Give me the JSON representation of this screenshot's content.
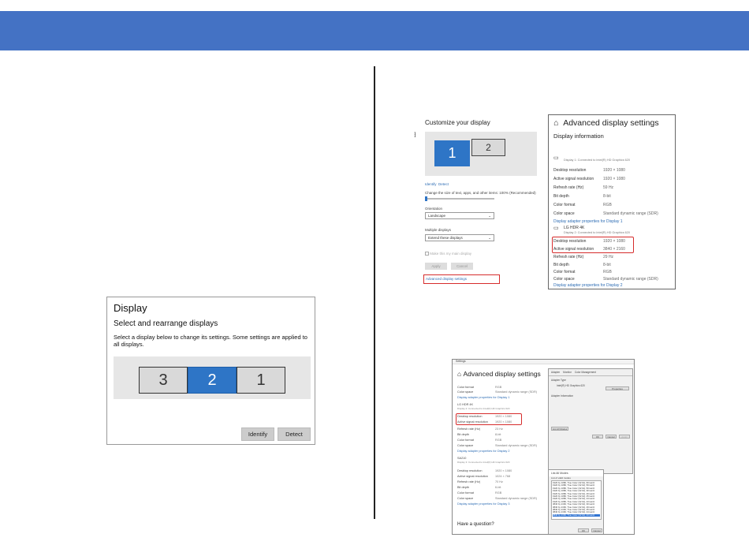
{
  "display_panel": {
    "title": "Display",
    "subtitle": "Select and rearrange displays",
    "description": "Select a display below to change its settings. Some settings are applied to all displays.",
    "monitors": [
      "3",
      "2",
      "1"
    ],
    "identify_label": "Identify",
    "detect_label": "Detect"
  },
  "customize_panel": {
    "title": "Customize your display",
    "tick": "⁆",
    "monitors": [
      "1",
      "2"
    ],
    "identify_label": "Identify",
    "detect_label": "Detect",
    "scale_label": "Change the size of text, apps, and other items: 100% (Recommended)",
    "orientation_label": "Orientation",
    "orientation_value": "Landscape",
    "multiple_label": "Multiple displays",
    "multiple_value": "Extend these displays",
    "main_display_label": "Make this my main display",
    "apply_label": "Apply",
    "cancel_label": "Cancel",
    "advanced_link": "Advanced display settings"
  },
  "advanced_panel": {
    "title": "Advanced display settings",
    "section": "Display information",
    "display1_caption": "Display 1: Connected to Intel(R) HD Graphics 620",
    "display1_rows": [
      {
        "k": "Desktop resolution",
        "v": "1920 × 1080"
      },
      {
        "k": "Active signal resolution",
        "v": "1920 × 1080"
      },
      {
        "k": "Refresh rate (Hz)",
        "v": "59 Hz"
      },
      {
        "k": "Bit depth",
        "v": "8-bit"
      },
      {
        "k": "Color format",
        "v": "RGB"
      },
      {
        "k": "Color space",
        "v": "Standard dynamic range (SDR)"
      }
    ],
    "display1_link": "Display adapter properties for Display 1",
    "display2_name": "LG HDR 4K",
    "display2_caption": "Display 2: Connected to Intel(R) HD Graphics 620",
    "display2_rows": [
      {
        "k": "Desktop resolution",
        "v": "1920 × 1080"
      },
      {
        "k": "Active signal resolution",
        "v": "3840 × 2160"
      },
      {
        "k": "Refresh rate (Hz)",
        "v": "29 Hz"
      },
      {
        "k": "Bit depth",
        "v": "8-bit"
      },
      {
        "k": "Color format",
        "v": "RGB"
      },
      {
        "k": "Color space",
        "v": "Standard dynamic range (SDR)"
      }
    ],
    "display2_link": "Display adapter properties for Display 2"
  },
  "shot": {
    "window_title": "Settings",
    "title": "Advanced display settings",
    "rows_a": [
      {
        "k": "Color format",
        "v": "RGB"
      },
      {
        "k": "Color space",
        "v": "Standard dynamic range (SDR)"
      }
    ],
    "link1": "Display adapter properties for Display 1",
    "lg_name": "LG HDR 4K",
    "lg_caption": "Display 2: Connected to Intel(R) HD Graphics 620",
    "rows_b": [
      {
        "k": "Desktop resolution",
        "v": "1920 × 1080"
      },
      {
        "k": "Active signal resolution",
        "v": "1920 × 1080"
      },
      {
        "k": "Refresh rate (Hz)",
        "v": "23 Hz"
      },
      {
        "k": "Bit depth",
        "v": "8-bit"
      },
      {
        "k": "Color format",
        "v": "RGB"
      },
      {
        "k": "Color space",
        "v": "Standard dynamic range (SDR)"
      }
    ],
    "link2": "Display adapter properties for Display 2",
    "sa_name": "SA210",
    "sa_caption": "Display 3: Connected to Intel(R) HD Graphics 620",
    "rows_c": [
      {
        "k": "Desktop resolution",
        "v": "1920 × 1080"
      },
      {
        "k": "Active signal resolution",
        "v": "1024 × 768"
      },
      {
        "k": "Refresh rate (Hz)",
        "v": "70 Hz"
      },
      {
        "k": "Bit depth",
        "v": "6-bit"
      },
      {
        "k": "Color format",
        "v": "RGB"
      },
      {
        "k": "Color space",
        "v": "Standard dynamic range (SDR)"
      }
    ],
    "link3": "Display adapter properties for Display 3",
    "question": "Have a question?",
    "props_tabs": [
      "Adapter",
      "Monitor",
      "Color Management"
    ],
    "props_adapter_type": "Adapter Type",
    "props_adapter_name": "Intel(R) HD Graphics 620",
    "props_properties": "Properties",
    "props_info": "Adapter Information",
    "props_list_button": "List All Modes",
    "props_ok": "OK",
    "props_cancel": "Cancel",
    "props_apply": "Apply",
    "list_title": "List All Modes",
    "list_caption": "List of valid modes",
    "list_items": [
      "1920 by 1080, True Color (32 bit), 60 Hertz",
      "1920 by 1080, True Color (32 bit), 59 Hertz",
      "1920 by 1080, True Color (32 bit), 50 Hertz",
      "1920 by 1080, True Color (32 bit), 30 Hertz",
      "1920 by 1080, True Color (32 bit), 29 Hertz",
      "1920 by 1080, True Color (32 bit), 25 Hertz",
      "1920 by 1080, True Color (32 bit), 24 Hertz",
      "1920 by 1080, True Color (32 bit), 23 Hertz",
      "3840 by 2160, True Color (32 bit), 30 Hertz",
      "3840 by 2160, True Color (32 bit), 29 Hertz",
      "3840 by 2160, True Color (32 bit), 25 Hertz",
      "3840 by 2160, True Color (32 bit), 24 Hertz",
      "3840 by 2160, True Color (32 bit), 23 Hertz"
    ],
    "list_ok": "OK",
    "list_cancel": "Cancel"
  },
  "colors": {
    "header": "#4472c4",
    "accent": "#2e75c6",
    "highlight": "#d62c2c"
  }
}
